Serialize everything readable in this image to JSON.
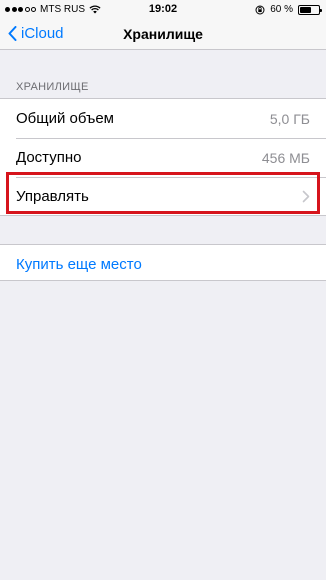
{
  "status_bar": {
    "carrier": "MTS RUS",
    "time": "19:02",
    "battery_text": "60 %",
    "battery_level": 0.6
  },
  "nav": {
    "back_label": "iCloud",
    "title": "Хранилище"
  },
  "storage_section": {
    "header": "ХРАНИЛИЩЕ",
    "rows": [
      {
        "label": "Общий объем",
        "value": "5,0 ГБ"
      },
      {
        "label": "Доступно",
        "value": "456 МБ"
      },
      {
        "label": "Управлять",
        "value": ">"
      }
    ]
  },
  "buy": {
    "label": "Купить еще место"
  },
  "colors": {
    "accent": "#007aff",
    "highlight": "#d6141c",
    "background": "#efeff4"
  }
}
